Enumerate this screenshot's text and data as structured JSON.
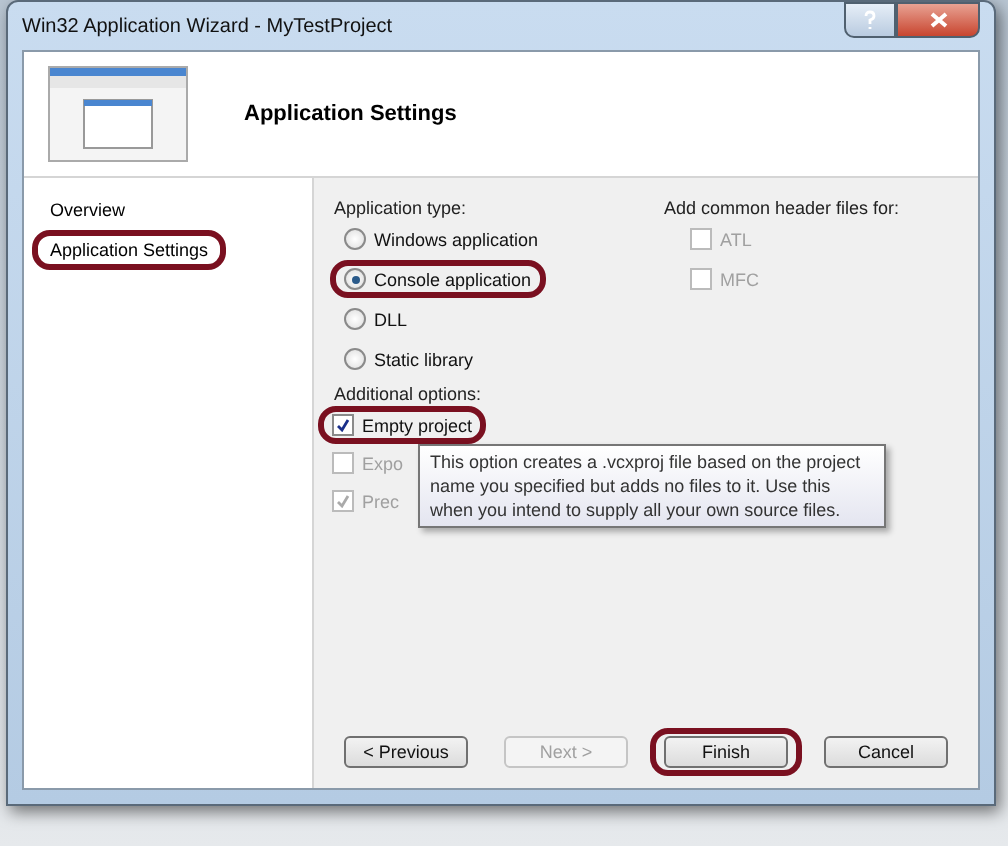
{
  "window": {
    "title": "Win32 Application Wizard - MyTestProject"
  },
  "header": {
    "title": "Application Settings"
  },
  "sidebar": {
    "items": [
      {
        "label": "Overview",
        "highlighted": false
      },
      {
        "label": "Application Settings",
        "highlighted": true
      }
    ]
  },
  "application_type": {
    "label": "Application type:",
    "options": [
      {
        "label": "Windows application",
        "selected": false,
        "highlighted": false
      },
      {
        "label": "Console application",
        "selected": true,
        "highlighted": true
      },
      {
        "label": "DLL",
        "selected": false,
        "highlighted": false
      },
      {
        "label": "Static library",
        "selected": false,
        "highlighted": false
      }
    ]
  },
  "additional_options": {
    "label": "Additional options:",
    "options": [
      {
        "label": "Empty project",
        "checked": true,
        "disabled": false,
        "highlighted": true
      },
      {
        "label": "Expo",
        "checked": false,
        "disabled": true,
        "highlighted": false
      },
      {
        "label": "Prec",
        "checked": true,
        "disabled": true,
        "highlighted": false
      }
    ]
  },
  "header_files": {
    "label": "Add common header files for:",
    "options": [
      {
        "label": "ATL",
        "checked": false,
        "disabled": true
      },
      {
        "label": "MFC",
        "checked": false,
        "disabled": true
      }
    ]
  },
  "tooltip": "This option creates a .vcxproj file based on the project name you specified but adds no files to it. Use this when you intend to supply all your own source files.",
  "buttons": [
    {
      "label": "< Previous",
      "disabled": false,
      "highlighted": false
    },
    {
      "label": "Next >",
      "disabled": true,
      "highlighted": false
    },
    {
      "label": "Finish",
      "disabled": false,
      "highlighted": true
    },
    {
      "label": "Cancel",
      "disabled": false,
      "highlighted": false
    }
  ]
}
